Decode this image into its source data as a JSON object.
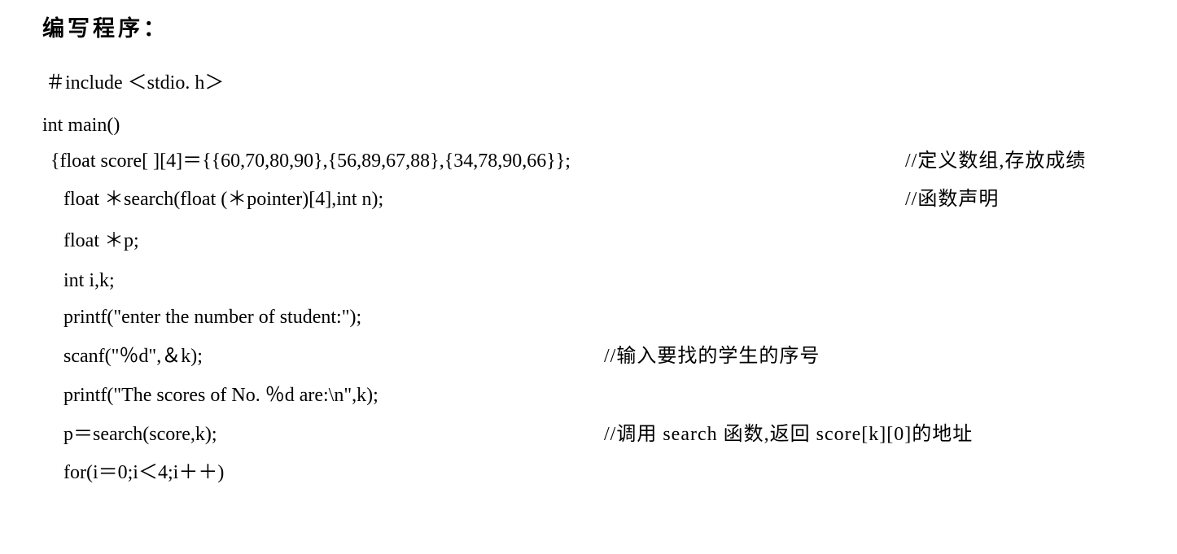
{
  "heading": "编写程序：",
  "lines": [
    {
      "code": "＃include ＜stdio. h＞",
      "comment": ""
    },
    {
      "code": "int main()",
      "comment": ""
    },
    {
      "code": "{float score[ ][4]＝{{60,70,80,90},{56,89,67,88},{34,78,90,66}};",
      "comment": "//定义数组,存放成绩"
    },
    {
      "code": "float ＊search(float (＊pointer)[4],int n);",
      "comment": "//函数声明"
    },
    {
      "code": "float ＊p;",
      "comment": ""
    },
    {
      "code": "int i,k;",
      "comment": ""
    },
    {
      "code": "printf(\"enter the number of student:\");",
      "comment": ""
    },
    {
      "code": "scanf(\"％d\",＆k);",
      "comment": "//输入要找的学生的序号"
    },
    {
      "code": "printf(\"The scores of No. ％d are:\\n\",k);",
      "comment": ""
    },
    {
      "code": "p＝search(score,k);",
      "comment": "//调用 search 函数,返回 score[k][0]的地址"
    },
    {
      "code": "for(i＝0;i＜4;i＋＋)",
      "comment": ""
    }
  ]
}
